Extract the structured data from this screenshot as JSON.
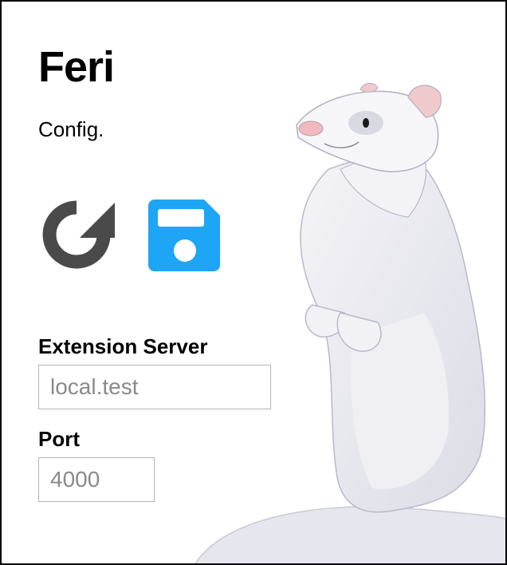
{
  "app": {
    "title": "Feri",
    "subtitle": "Config."
  },
  "toolbar": {
    "reload_icon": "reload-icon",
    "save_icon": "floppy-disk-save-icon",
    "reload_color": "#4a4a4a",
    "save_color": "#1ea5f5"
  },
  "form": {
    "server_label": "Extension Server",
    "server_value": "local.test",
    "port_label": "Port",
    "port_value": "4000"
  }
}
